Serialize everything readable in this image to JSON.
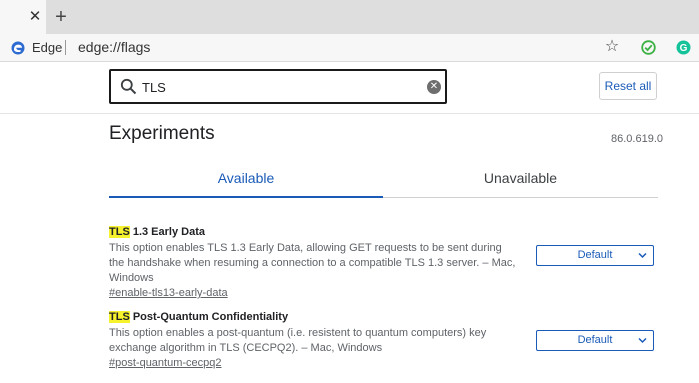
{
  "tabstrip": {
    "close_glyph": "✕",
    "new_tab_glyph": "+"
  },
  "toolbar": {
    "site_name": "Edge",
    "url": "edge://flags",
    "star_glyph": "☆",
    "icons": [
      "edge-logo-icon",
      "star-icon",
      "extension-green-check-icon",
      "extension-grammarly-icon"
    ]
  },
  "search": {
    "value": "TLS",
    "clear_glyph": "✕"
  },
  "header": {
    "reset_label": "Reset all",
    "title": "Experiments",
    "version": "86.0.619.0"
  },
  "tabs": [
    {
      "label": "Available",
      "selected": true
    },
    {
      "label": "Unavailable",
      "selected": false
    }
  ],
  "experiments": [
    {
      "title_highlight": "TLS",
      "title_rest": " 1.3 Early Data",
      "description": "This option enables TLS 1.3 Early Data, allowing GET requests to be sent during the handshake when resuming a connection to a compatible TLS 1.3 server. – Mac, Windows",
      "link": "#enable-tls13-early-data",
      "select_value": "Default"
    },
    {
      "title_highlight": "TLS",
      "title_rest": " Post-Quantum Confidentiality",
      "description": "This option enables a post-quantum (i.e. resistent to quantum computers) key exchange algorithm in TLS (CECPQ2). – Mac, Windows",
      "link": "#post-quantum-cecpq2",
      "select_value": "Default"
    }
  ],
  "colors": {
    "accent": "#1a5bb8",
    "highlight": "#f7f22e",
    "tabstrip": "#dedede",
    "ext_green": "#3cb043"
  }
}
